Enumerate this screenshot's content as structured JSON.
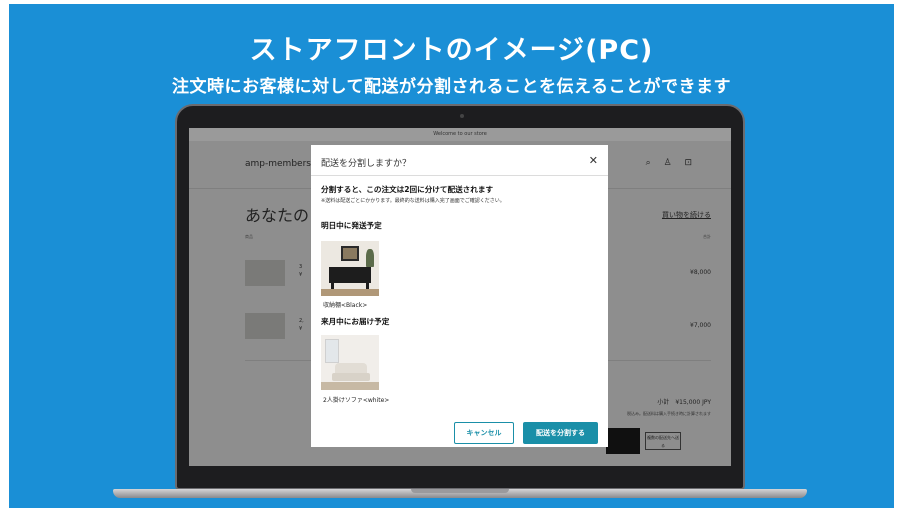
{
  "banner": {
    "title": "ストアフロントのイメージ(PC)",
    "subtitle": "注文時にお客様に対して配送が分割されることを伝えることができます"
  },
  "store": {
    "announcement": "Welcome to our store",
    "brand": "amp-membersh",
    "header_icons": "⌕ ♙ ⊡",
    "cart_title": "あなたの",
    "continue_shopping": "買い物を続ける",
    "col_product": "商品",
    "col_total": "合計",
    "items": [
      {
        "name": "3",
        "sub": "¥",
        "price": "¥8,000"
      },
      {
        "name": "2,",
        "sub": "¥",
        "price": "¥7,000"
      }
    ],
    "subtotal": "小計　¥15,000 JPY",
    "tax_note": "税込み。配送料は購入手続き時に計算されます",
    "multi_delivery": "複数の配送先へ送る"
  },
  "modal": {
    "title": "配送を分割しますか？",
    "close_symbol": "✕",
    "lead": "分割すると、この注文は2回に分けて配送されます",
    "note": "※送料は配送ごとにかかります。最終的な送料は購入完了画面でご確認ください。",
    "section1_label": "明日中に発送予定",
    "item1_caption": "収納棚<Black>",
    "section2_label": "来月中にお届け予定",
    "item2_caption": "2人掛けソファ<white>",
    "cancel_label": "キャンセル",
    "split_label": "配送を分割する"
  },
  "colors": {
    "background": "#1a8fd6",
    "accent": "#1a8fa8"
  }
}
